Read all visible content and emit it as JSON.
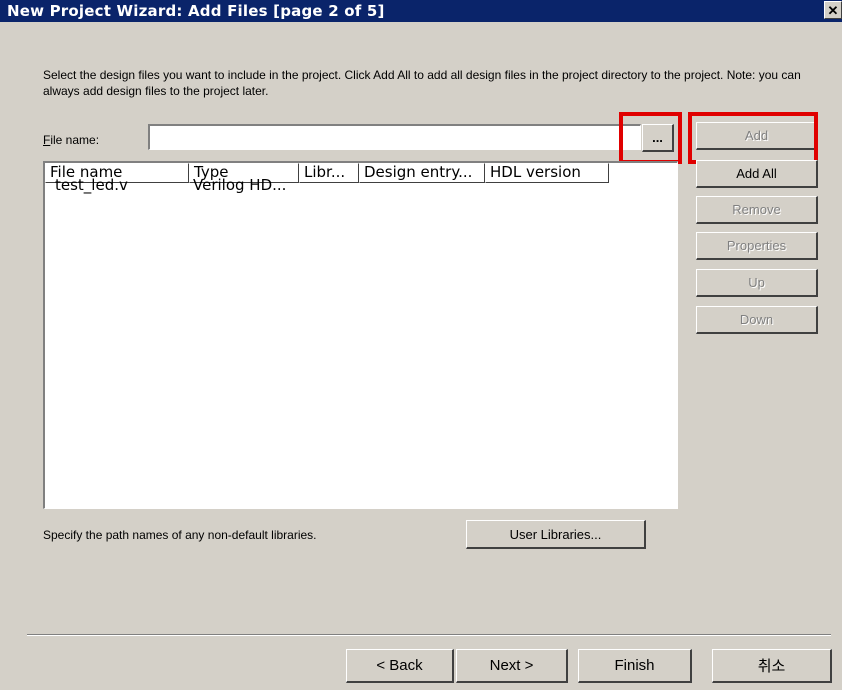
{
  "window": {
    "title": "New Project Wizard: Add Files [page 2 of 5]",
    "close_glyph": "✕"
  },
  "description": "Select the design files you want to include in the project. Click Add All to add all design files in the project directory to the project. Note: you can always add design files to the project later.",
  "file_name": {
    "label_accel": "F",
    "label_rest": "ile name:",
    "value": "",
    "browse_label": "..."
  },
  "buttons": {
    "add": "Add",
    "add_all": "Add All",
    "remove": "Remove",
    "properties": "Properties",
    "up": "Up",
    "down": "Down"
  },
  "file_list": {
    "columns": [
      "File name",
      "Type",
      "Libr...",
      "Design entry...",
      "HDL version"
    ],
    "rows": [
      {
        "file_name": "test_led.v",
        "type": "Verilog HD..."
      }
    ]
  },
  "libraries": {
    "hint": "Specify the path names of any non-default libraries.",
    "user_libraries_label": "User Libraries..."
  },
  "nav": {
    "back": "< Back",
    "next": "Next >",
    "finish": "Finish",
    "cancel": "취소"
  },
  "highlight_color": "#e00000"
}
